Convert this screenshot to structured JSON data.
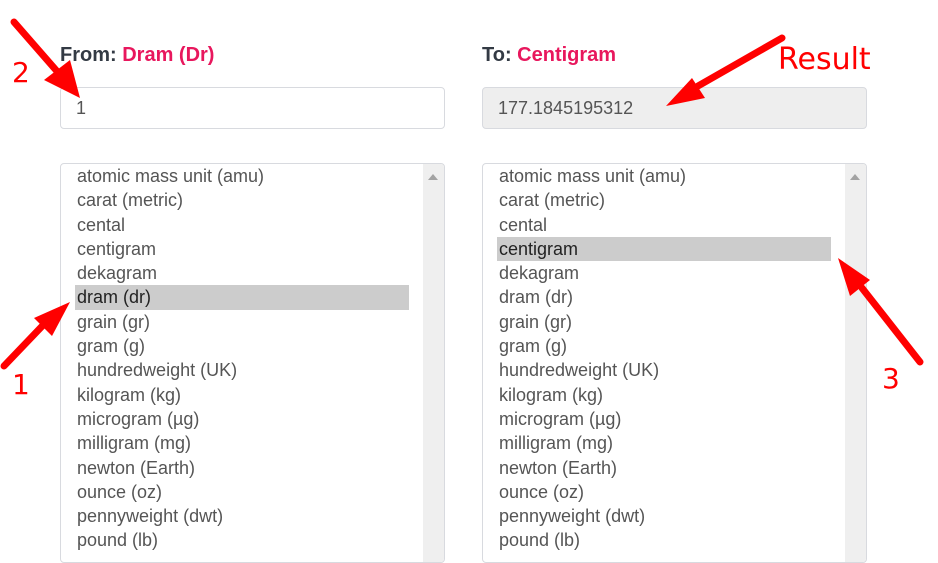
{
  "from": {
    "label_prefix": "From:",
    "unit_name": "Dram (Dr)",
    "input_value": "1",
    "selected_option": "dram (dr)"
  },
  "to": {
    "label_prefix": "To:",
    "unit_name": "Centigram",
    "result_value": "177.1845195312",
    "selected_option": "centigram"
  },
  "units": [
    "atomic mass unit (amu)",
    "carat (metric)",
    "cental",
    "centigram",
    "dekagram",
    "dram (dr)",
    "grain (gr)",
    "gram (g)",
    "hundredweight (UK)",
    "kilogram (kg)",
    "microgram (µg)",
    "milligram (mg)",
    "newton (Earth)",
    "ounce (oz)",
    "pennyweight (dwt)",
    "pound (lb)"
  ],
  "annotations": {
    "step1": "1",
    "step2": "2",
    "step3": "3",
    "result": "Result",
    "color": "#ff0000"
  },
  "colors": {
    "accent": "#e8175d",
    "label": "#333a44",
    "selection": "#cccccc",
    "readonly_bg": "#eeeeee"
  }
}
